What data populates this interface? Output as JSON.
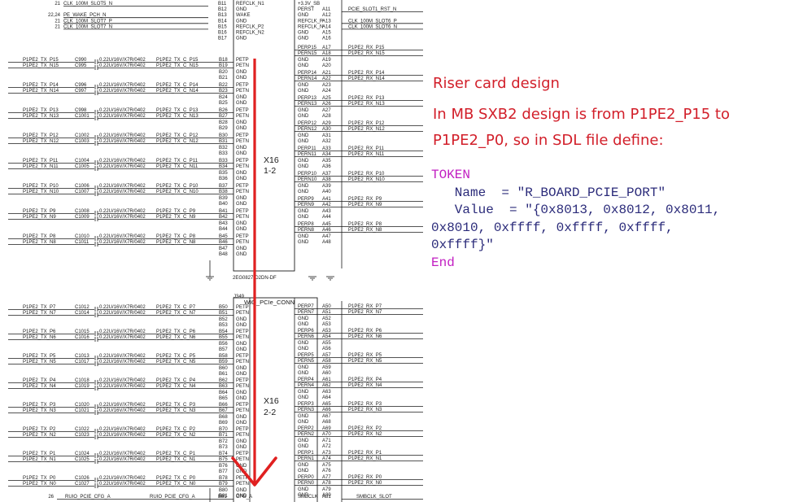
{
  "note": {
    "title": "Riser card design",
    "lines": [
      "In MB SXB2 design is from P1PE2_P15 to",
      "P1PE2_P0, so in SDL file define:"
    ],
    "color": "#d21f2a"
  },
  "code": {
    "token": "TOKEN",
    "name_line": "   Name  = \"R_BOARD_PCIE_PORT\"",
    "value_line": "   Value  = \"{0x8013, 0x8012, 0x8011,",
    "cont1": "0x8010, 0xffff, 0xffff, 0xffff,",
    "cont2": "0xffff}\"",
    "end": "End",
    "keyword_color": "#c21fc2",
    "text_color": "#2b2b7a"
  },
  "schematic": {
    "top_rows": [
      {
        "left_num": "21",
        "net": "CLK_100M_SLOT5_N",
        "pin": "B11",
        "sig": "REFCLK_N1",
        "rpin": "",
        "rnet": "",
        "xnum": "",
        "rsig": "+3.3V_SB"
      },
      {
        "left_num": "",
        "net": "",
        "pin": "B12",
        "sig": "GND",
        "rpin": "A11",
        "rnet": "PCIE_SLOT1_RST_N",
        "xnum": "",
        "rsig": "PERST"
      },
      {
        "left_num": "22,24",
        "net": "PE_WAKE_PCH_N",
        "pin": "B13",
        "sig": "WAKE",
        "rpin": "A12",
        "rnet": "",
        "xnum": "",
        "rsig": "GND"
      },
      {
        "left_num": "21",
        "net": "CLK_100M_SLOT7_P",
        "pin": "B14",
        "sig": "GND",
        "rpin": "A13",
        "rnet": "CLK_100M_SLOT6_P",
        "xnum": "",
        "rsig": "REFCLK_P"
      },
      {
        "left_num": "21",
        "net": "CLK_100M_SLOT7_N",
        "pin": "B15",
        "sig": "REFCLK_P2",
        "rpin": "A14",
        "rnet": "CLK_100M_SLOT6_N",
        "xnum": "",
        "rsig": "REFCLK_N"
      },
      {
        "left_num": "",
        "net": "",
        "pin": "B16",
        "sig": "REFCLK_N2",
        "rpin": "A15",
        "rnet": "",
        "xnum": "",
        "rsig": "GND"
      },
      {
        "left_num": "",
        "net": "",
        "pin": "B17",
        "sig": "GND",
        "rpin": "A16",
        "rnet": "",
        "xnum": "",
        "rsig": "GND"
      }
    ],
    "connector2_ref": "J349",
    "connector2_name": "WIO_PCIe_CONN",
    "part_number": "2EG0827-D2DN-DF",
    "label_x16_1": "X16",
    "label_x16_1_sub": "1-2",
    "label_x16_2": "X16",
    "label_x16_2_sub": "2-2",
    "cap_value": "0.22U/16V/X7R/0402",
    "lanes1": [
      {
        "n": "15",
        "cp": "C990",
        "cn": "C995",
        "bp": "B18",
        "bn": "B19",
        "rp": "A17",
        "rn": "A18"
      },
      {
        "n": "14",
        "cp": "C996",
        "cn": "C997",
        "bp": "B22",
        "bn": "B23",
        "rp": "A21",
        "rn": "A22"
      },
      {
        "n": "13",
        "cp": "C998",
        "cn": "C1001",
        "bp": "B26",
        "bn": "B27",
        "rp": "A25",
        "rn": "A26"
      },
      {
        "n": "12",
        "cp": "C1002",
        "cn": "C1003",
        "bp": "B30",
        "bn": "B31",
        "rp": "A29",
        "rn": "A30"
      },
      {
        "n": "11",
        "cp": "C1004",
        "cn": "C1005",
        "bp": "B33",
        "bn": "B34",
        "rp": "A33",
        "rn": "A34"
      },
      {
        "n": "10",
        "cp": "C1006",
        "cn": "C1007",
        "bp": "B37",
        "bn": "B38",
        "rp": "A37",
        "rn": "A38"
      },
      {
        "n": "9",
        "cp": "C1008",
        "cn": "C1009",
        "bp": "B41",
        "bn": "B42",
        "rp": "A41",
        "rn": "A42"
      },
      {
        "n": "8",
        "cp": "C1010",
        "cn": "C1011",
        "bp": "B45",
        "bn": "B46",
        "rp": "A45",
        "rn": "A46"
      }
    ],
    "lanes2": [
      {
        "n": "7",
        "cp": "C1012",
        "cn": "C1014",
        "bp": "B50",
        "bn": "B51",
        "rp": "A50",
        "rn": "A51"
      },
      {
        "n": "6",
        "cp": "C1015",
        "cn": "C1016",
        "bp": "B54",
        "bn": "B55",
        "rp": "A53",
        "rn": "A54"
      },
      {
        "n": "5",
        "cp": "C1013",
        "cn": "C1017",
        "bp": "B58",
        "bn": "B59",
        "rp": "A57",
        "rn": "A58"
      },
      {
        "n": "4",
        "cp": "C1018",
        "cn": "C1019",
        "bp": "B62",
        "bn": "B63",
        "rp": "A61",
        "rn": "A62"
      },
      {
        "n": "3",
        "cp": "C1020",
        "cn": "C1021",
        "bp": "B66",
        "bn": "B67",
        "rp": "A65",
        "rn": "A66"
      },
      {
        "n": "2",
        "cp": "C1022",
        "cn": "C1023",
        "bp": "B70",
        "bn": "B71",
        "rp": "A69",
        "rn": "A70"
      },
      {
        "n": "1",
        "cp": "C1024",
        "cn": "C1025",
        "bp": "B74",
        "bn": "B75",
        "rp": "A73",
        "rn": "A74"
      },
      {
        "n": "0",
        "cp": "C1026",
        "cn": "C1027",
        "bp": "B78",
        "bn": "B79",
        "rp": "A77",
        "rn": "A78"
      }
    ],
    "bottom_rows": [
      {
        "left_num": "26",
        "net": "RUIO_PCIE_CFG_A",
        "net2": "RUIO_PCIE_CFG_A",
        "pin": "B81",
        "sig": "CFG_A",
        "rsig": "SMBCLK",
        "rpin": "A81",
        "rnet": "SMBCLK_SLOT"
      }
    ],
    "arrow_color": "#e02020"
  }
}
